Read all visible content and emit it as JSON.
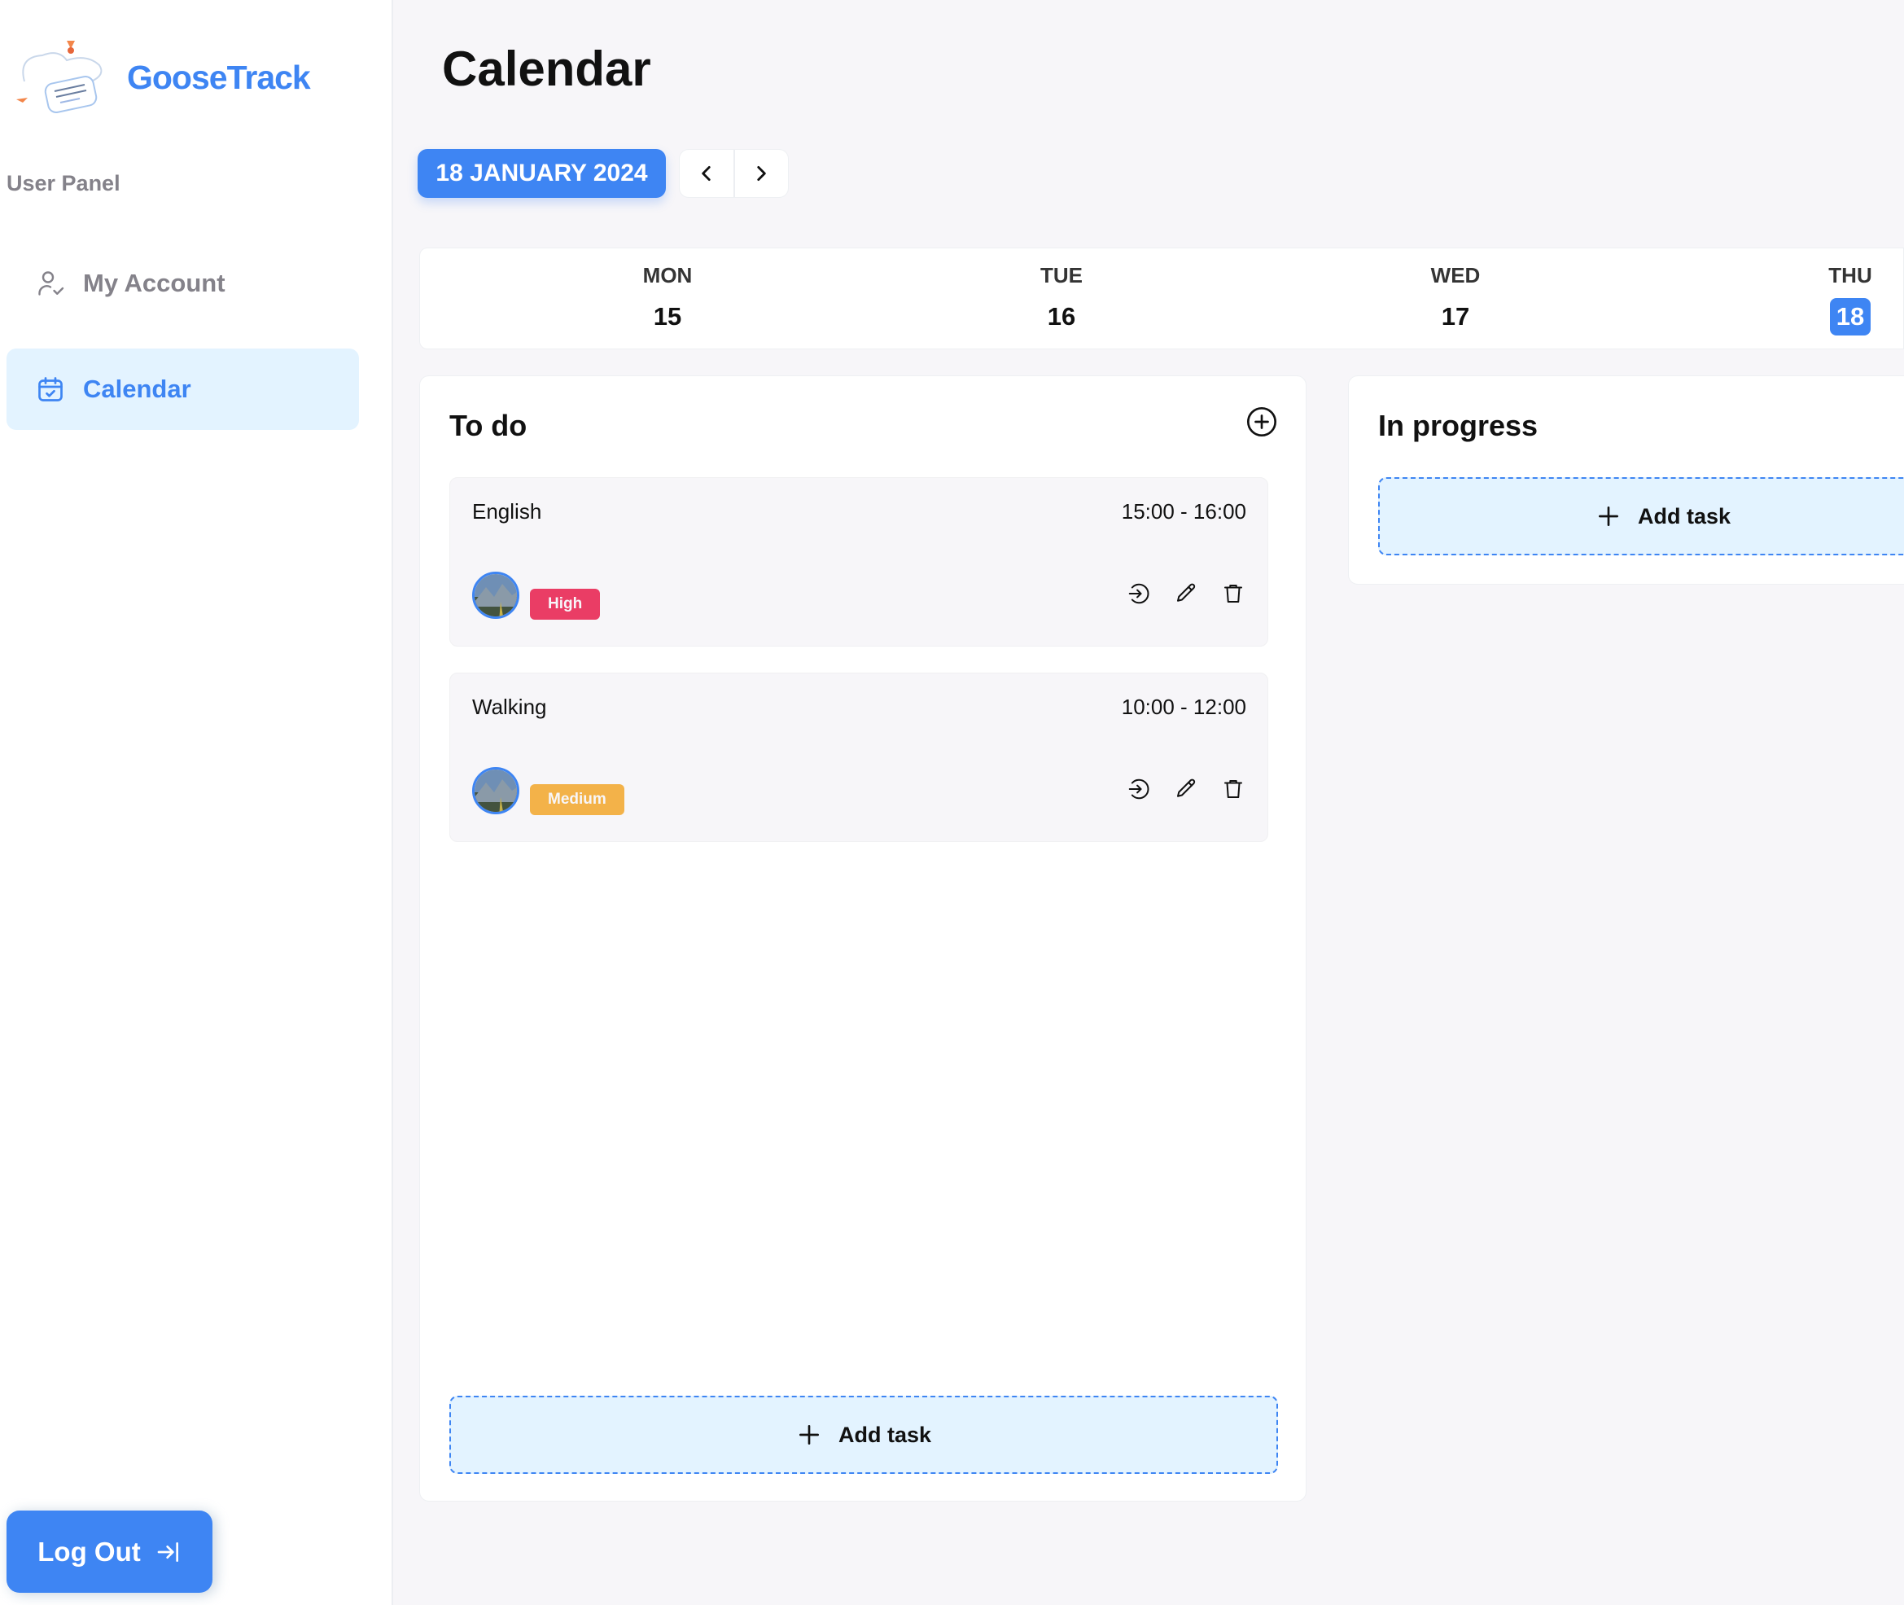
{
  "brand": {
    "name": "GooseTrack",
    "logo_icon": "goose-logo"
  },
  "sidebar": {
    "section_label": "User Panel",
    "items": [
      {
        "label": "My Account",
        "icon": "user-check-icon",
        "active": false
      },
      {
        "label": "Calendar",
        "icon": "calendar-check-icon",
        "active": true
      }
    ],
    "logout_label": "Log Out"
  },
  "page": {
    "title": "Calendar"
  },
  "toolbar": {
    "current_date": "18 JANUARY 2024"
  },
  "week": {
    "days": [
      {
        "name": "MON",
        "number": "15"
      },
      {
        "name": "TUE",
        "number": "16"
      },
      {
        "name": "WED",
        "number": "17"
      },
      {
        "name": "THU",
        "number": "18",
        "active": true
      }
    ]
  },
  "columns": {
    "todo": {
      "title": "To do",
      "tasks": [
        {
          "title": "English",
          "time": "15:00 - 16:00",
          "priority": "High"
        },
        {
          "title": "Walking",
          "time": "10:00 - 12:00",
          "priority": "Medium"
        }
      ],
      "add_label": "Add task"
    },
    "in_progress": {
      "title": "In progress",
      "add_label": "Add task"
    }
  },
  "colors": {
    "accent": "#3e85f3",
    "accent_light": "#e3f3ff",
    "priority_high": "#ea3d65",
    "priority_medium": "#f3b249"
  }
}
